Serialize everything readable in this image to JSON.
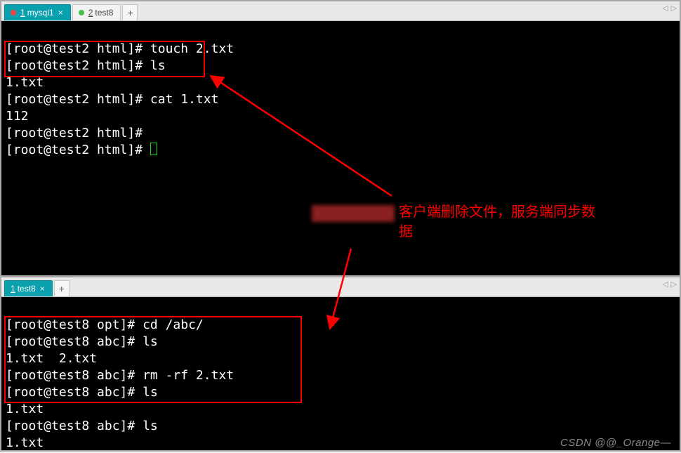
{
  "top_pane": {
    "tabs": [
      {
        "num": "1",
        "label": "mysql1",
        "dot": "red",
        "active": true,
        "closeable": true
      },
      {
        "num": "2",
        "label": "test8",
        "dot": "green",
        "active": false,
        "closeable": false
      }
    ],
    "terminal_lines": [
      {
        "prompt": "[root@test2 html]# ",
        "cmd": "touch 2.txt"
      },
      {
        "prompt": "[root@test2 html]# ",
        "cmd": "ls"
      },
      {
        "out": "1.txt"
      },
      {
        "prompt": "[root@test2 html]# ",
        "cmd": "cat 1.txt"
      },
      {
        "out": "112"
      },
      {
        "prompt": "[root@test2 html]# ",
        "cmd": ""
      },
      {
        "prompt": "[root@test2 html]# ",
        "cmd": "",
        "cursor": true
      }
    ]
  },
  "bottom_pane": {
    "tabs": [
      {
        "num": "1",
        "label": "test8",
        "active": true,
        "closeable": true
      }
    ],
    "terminal_lines": [
      {
        "prompt": "[root@test8 opt]# ",
        "cmd": "cd /abc/"
      },
      {
        "prompt": "[root@test8 abc]# ",
        "cmd": "ls"
      },
      {
        "out": "1.txt  2.txt"
      },
      {
        "prompt": "[root@test8 abc]# ",
        "cmd": "rm -rf 2.txt"
      },
      {
        "prompt": "[root@test8 abc]# ",
        "cmd": "ls"
      },
      {
        "out": "1.txt"
      },
      {
        "prompt": "[root@test8 abc]# ",
        "cmd": "ls"
      },
      {
        "out": "1.txt"
      }
    ]
  },
  "annotation": {
    "text": "客户端删除文件，服务端同步数据"
  },
  "watermark": "CSDN @@_Orange—",
  "add_tab_glyph": "+",
  "nav_left": "◁",
  "nav_right": "▷",
  "close_glyph": "×"
}
